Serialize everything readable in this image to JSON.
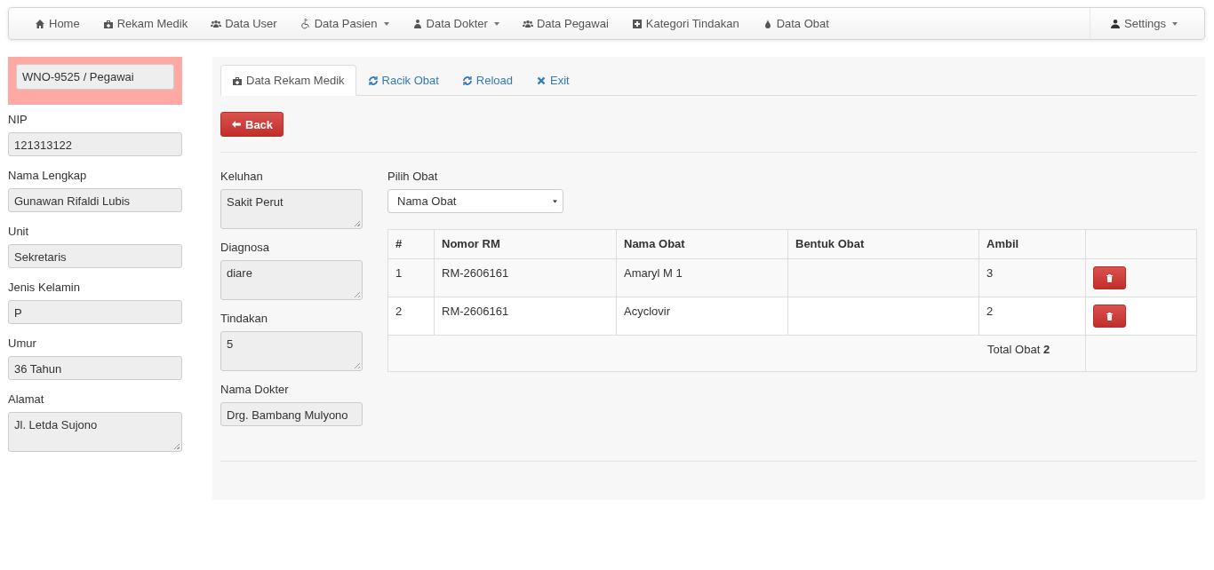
{
  "navbar": {
    "items": [
      {
        "label": "Home",
        "kind": "home",
        "dropdown": false
      },
      {
        "label": "Rekam Medik",
        "kind": "medkit",
        "dropdown": false
      },
      {
        "label": "Data User",
        "kind": "users",
        "dropdown": false
      },
      {
        "label": "Data Pasien",
        "kind": "wheelchair",
        "dropdown": true
      },
      {
        "label": "Data Dokter",
        "kind": "doctor",
        "dropdown": true
      },
      {
        "label": "Data Pegawai",
        "kind": "users",
        "dropdown": false
      },
      {
        "label": "Kategori Tindakan",
        "kind": "plus",
        "dropdown": false
      },
      {
        "label": "Data Obat",
        "kind": "drop",
        "dropdown": false
      }
    ],
    "settings": {
      "label": "Settings",
      "dropdown": true
    }
  },
  "profile": {
    "badge": "WNO-9525 / Pegawai",
    "fields": [
      {
        "label": "NIP",
        "value": "121313122",
        "kind": "input"
      },
      {
        "label": "Nama Lengkap",
        "value": "Gunawan Rifaldi Lubis",
        "kind": "input"
      },
      {
        "label": "Unit",
        "value": "Sekretaris",
        "kind": "input"
      },
      {
        "label": "Jenis Kelamin",
        "value": "P",
        "kind": "input"
      },
      {
        "label": "Umur",
        "value": "36 Tahun",
        "kind": "input"
      },
      {
        "label": "Alamat",
        "value": "Jl. Letda Sujono",
        "kind": "textarea"
      }
    ]
  },
  "tabs": [
    {
      "label": "Data Rekam Medik",
      "kind": "medkit",
      "selected": true
    },
    {
      "label": "Racik Obat",
      "kind": "refresh",
      "selected": false
    },
    {
      "label": "Reload",
      "kind": "refresh",
      "selected": false
    },
    {
      "label": "Exit",
      "kind": "close",
      "selected": false
    }
  ],
  "back_button": "Back",
  "record": [
    {
      "label": "Keluhan",
      "value": "Sakit Perut",
      "kind": "textarea"
    },
    {
      "label": "Diagnosa",
      "value": "diare",
      "kind": "textarea"
    },
    {
      "label": "Tindakan",
      "value": "5",
      "kind": "textarea"
    },
    {
      "label": "Nama Dokter",
      "value": "Drg. Bambang Mulyono",
      "kind": "input"
    }
  ],
  "medicine_select": {
    "label": "Pilih Obat",
    "value": "Nama Obat"
  },
  "table": {
    "columns": [
      "#",
      "Nomor RM",
      "Nama Obat",
      "Bentuk Obat",
      "Ambil"
    ],
    "rows": [
      [
        "1",
        "RM-2606161",
        "Amaryl M 1",
        "",
        "3"
      ],
      [
        "2",
        "RM-2606161",
        "Acyclovir",
        "",
        "2"
      ]
    ],
    "total": "Total Obat **2**"
  }
}
